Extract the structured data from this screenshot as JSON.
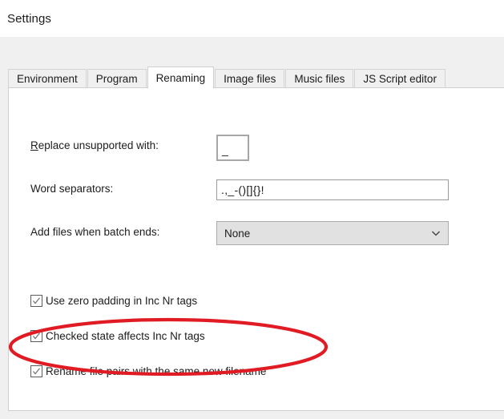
{
  "window": {
    "title": "Settings"
  },
  "tabs": [
    {
      "label": "Environment",
      "selected": false
    },
    {
      "label": "Program",
      "selected": false
    },
    {
      "label": "Renaming",
      "selected": true
    },
    {
      "label": "Image files",
      "selected": false
    },
    {
      "label": "Music files",
      "selected": false
    },
    {
      "label": "JS Script editor",
      "selected": false
    }
  ],
  "fields": {
    "replace_unsupported": {
      "label_accel": "R",
      "label_rest": "eplace unsupported with:",
      "value": "_"
    },
    "word_separators": {
      "label": "Word separators:",
      "value": ".,_-()[]{}!"
    },
    "add_files_when_batch_ends": {
      "label": "Add files when batch ends:",
      "value": "None",
      "chevron_icon": "chevron-down-icon"
    }
  },
  "checkboxes": [
    {
      "label": "Use zero padding in Inc Nr tags",
      "checked": true
    },
    {
      "label": "Checked state affects Inc Nr tags",
      "checked": true
    },
    {
      "label": "Rename file pairs with the same new filename",
      "checked": true
    }
  ],
  "annotation": {
    "shape": "ellipse",
    "color": "#e01b24",
    "target": "Rename file pairs with the same new filename"
  },
  "colors": {
    "dialog_background": "#f0f0f0",
    "panel_background": "#ffffff",
    "text": "#1c1c1c",
    "annotation_red": "#e01b24"
  }
}
